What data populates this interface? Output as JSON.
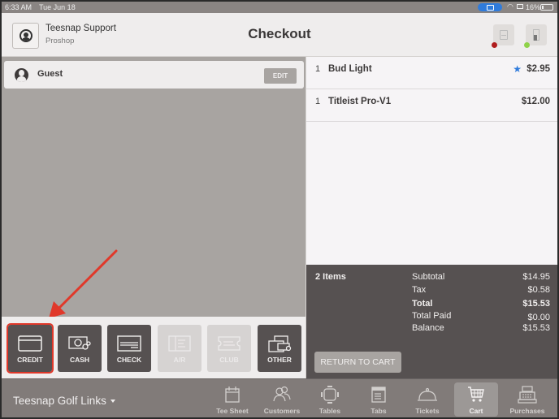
{
  "status_bar": {
    "time": "6:33 AM",
    "date": "Tue Jun 18",
    "battery_percent": "16%",
    "battery_level": 0.16,
    "airplay_color": "#2f7bdc"
  },
  "header": {
    "user_name": "Teesnap Support",
    "user_role": "Proshop",
    "title": "Checkout",
    "printer_status": "disconnected",
    "drawer_status": "connected"
  },
  "customer": {
    "name": "Guest",
    "edit_label": "EDIT"
  },
  "tenders": [
    {
      "label": "CREDIT",
      "icon": "credit-card-icon",
      "enabled": true,
      "highlighted": true
    },
    {
      "label": "CASH",
      "icon": "cash-icon",
      "enabled": true
    },
    {
      "label": "CHECK",
      "icon": "check-icon",
      "enabled": true
    },
    {
      "label": "A/R",
      "icon": "accounts-receivable-icon",
      "enabled": false
    },
    {
      "label": "CLUB",
      "icon": "club-ticket-icon",
      "enabled": false
    },
    {
      "label": "OTHER",
      "icon": "other-payment-icon",
      "enabled": true
    }
  ],
  "cart": {
    "lines": [
      {
        "qty": "1",
        "name": "Bud Light",
        "price": "$2.95",
        "starred": true
      },
      {
        "qty": "1",
        "name": "Titleist Pro-V1",
        "price": "$12.00",
        "starred": false
      }
    ],
    "item_count": "2 Items",
    "summary": [
      {
        "label": "Subtotal",
        "value": "$14.95",
        "bold": false
      },
      {
        "label": "Tax",
        "value": "$0.58",
        "bold": false
      },
      {
        "label": "Total",
        "value": "$15.53",
        "bold": true
      },
      {
        "label": "Total Paid",
        "value": "$0.00",
        "bold": false
      },
      {
        "label": "Balance",
        "value": "$15.53",
        "bold": false
      }
    ],
    "return_label": "RETURN TO CART"
  },
  "bottom_bar": {
    "location": "Teesnap Golf Links",
    "nav": [
      {
        "label": "Tee Sheet",
        "icon": "calendar-icon",
        "active": false
      },
      {
        "label": "Customers",
        "icon": "customers-icon",
        "active": false
      },
      {
        "label": "Tables",
        "icon": "tables-icon",
        "active": false
      },
      {
        "label": "Tabs",
        "icon": "tabs-icon",
        "active": false
      },
      {
        "label": "Tickets",
        "icon": "cloche-icon",
        "active": false
      },
      {
        "label": "Cart",
        "icon": "cart-icon",
        "active": true
      },
      {
        "label": "Purchases",
        "icon": "cash-register-icon",
        "active": false
      }
    ]
  },
  "annotation": {
    "arrow_color": "#e0382a",
    "target": "CREDIT"
  }
}
